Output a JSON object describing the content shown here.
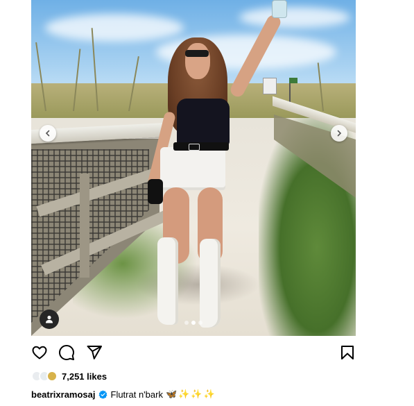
{
  "post": {
    "carousel": {
      "slide_count": 3,
      "active_slide": 2
    }
  },
  "actions": {
    "like_icon": "heart-icon",
    "comment_icon": "comment-icon",
    "share_icon": "paper-plane-icon",
    "save_icon": "bookmark-icon"
  },
  "likes": {
    "count_text": "7,251 likes"
  },
  "caption": {
    "username": "beatrixramosaj",
    "text": "Flutrat n'bark",
    "emojis": [
      "🦋",
      "✨",
      "✨",
      "✨"
    ]
  },
  "colors": {
    "verified_badge": "#0095f6",
    "text": "#000000"
  }
}
